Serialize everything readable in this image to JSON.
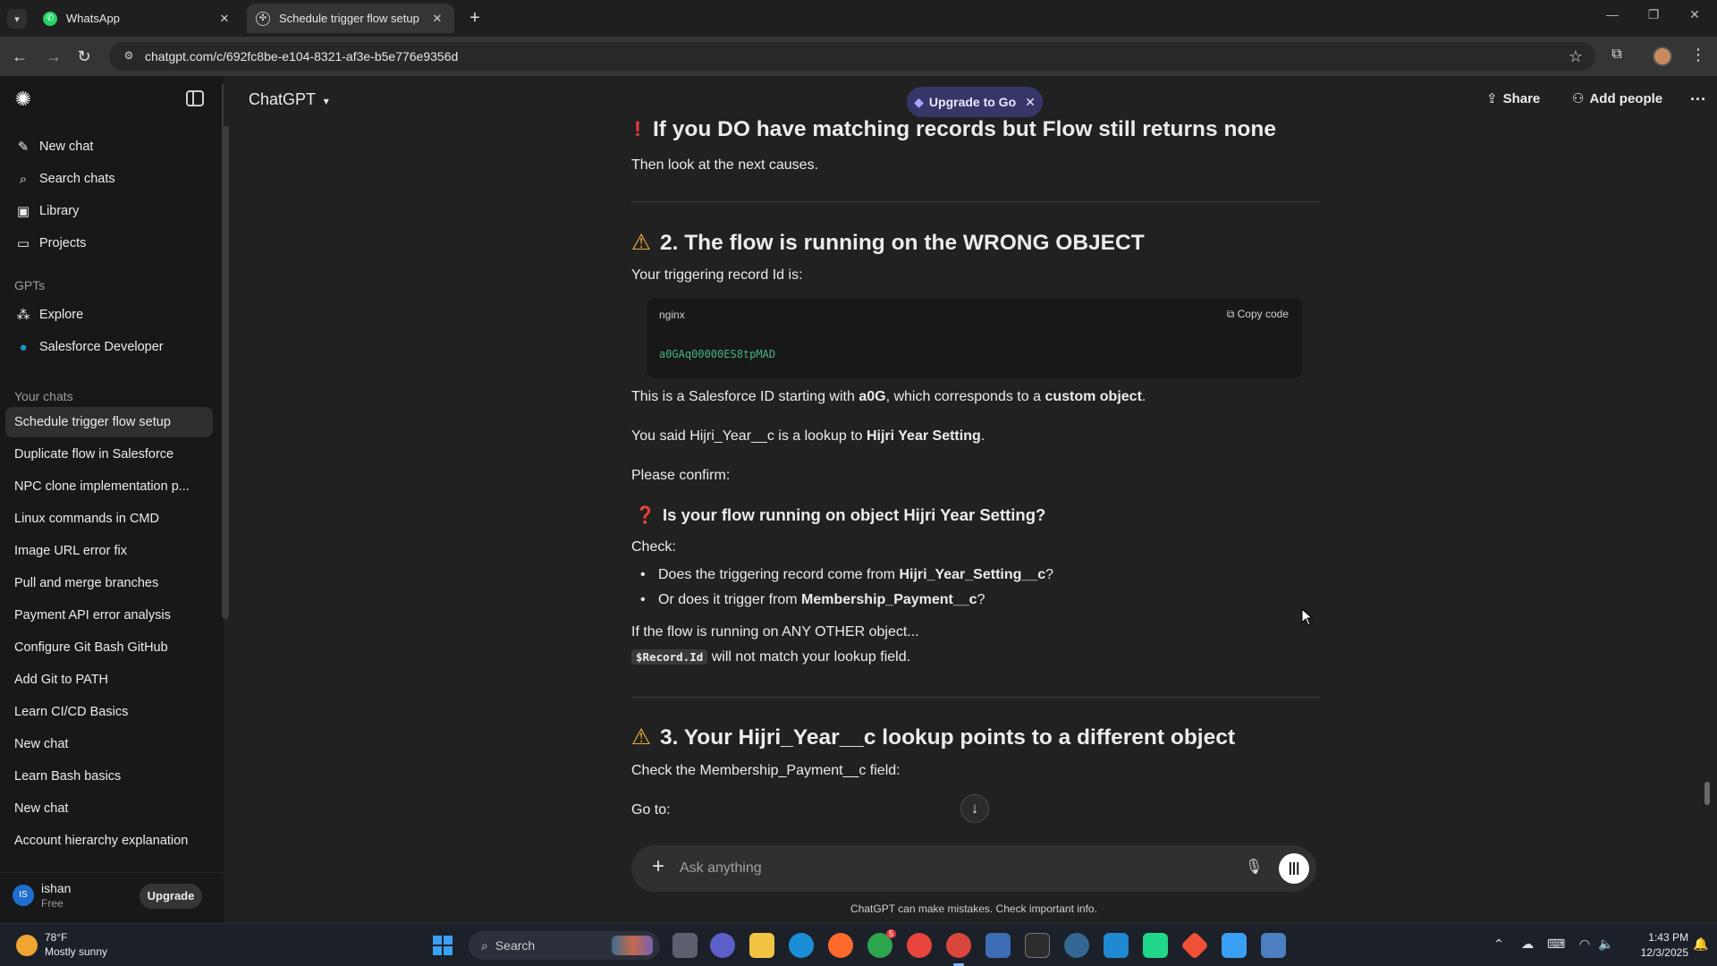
{
  "browser": {
    "tabs": [
      {
        "title": "WhatsApp",
        "active": false
      },
      {
        "title": "Schedule trigger flow setup",
        "active": true
      }
    ],
    "url": "chatgpt.com/c/692fc8be-e104-8321-af3e-b5e776e9356d"
  },
  "sidebar": {
    "top_items": [
      {
        "label": "New chat",
        "icon": "edit-icon"
      },
      {
        "label": "Search chats",
        "icon": "search-icon"
      },
      {
        "label": "Library",
        "icon": "library-icon"
      },
      {
        "label": "Projects",
        "icon": "folder-icon"
      }
    ],
    "gpts_heading": "GPTs",
    "gpts": [
      {
        "label": "Explore",
        "icon": "grid-icon"
      },
      {
        "label": "Salesforce Developer",
        "icon": "salesforce-icon"
      }
    ],
    "chats_heading": "Your chats",
    "chats": [
      "Schedule trigger flow setup",
      "Duplicate flow in Salesforce",
      "NPC clone implementation p...",
      "Linux commands in CMD",
      "Image URL error fix",
      "Pull and merge branches",
      "Payment API error analysis",
      "Configure Git Bash GitHub",
      "Add Git to PATH",
      "Learn CI/CD Basics",
      "New chat",
      "Learn Bash basics",
      "New chat",
      "Account hierarchy explanation"
    ],
    "user": {
      "initials": "IS",
      "name": "ishan",
      "plan": "Free",
      "upgrade_label": "Upgrade"
    }
  },
  "header": {
    "model": "ChatGPT",
    "upgrade_pill": "Upgrade to Go",
    "share": "Share",
    "add_people": "Add people"
  },
  "message": {
    "h_none": "If you DO have matching records but Flow still returns none",
    "p_next": "Then look at the next causes.",
    "h_wrong": "2. The flow is running on the WRONG OBJECT",
    "p_trigger": "Your triggering record Id is:",
    "code": {
      "lang": "nginx",
      "copy": "Copy code",
      "line": "a0GAq00000ES8tpMAD"
    },
    "p_sf_1": "This is a Salesforce ID starting with ",
    "p_sf_b1": "a0G",
    "p_sf_2": ", which corresponds to a ",
    "p_sf_b2": "custom object",
    "p_sf_3": ".",
    "p_said_1": "You said Hijri_Year__c is a lookup to ",
    "p_said_b": "Hijri Year Setting",
    "p_said_2": ".",
    "p_confirm": "Please confirm:",
    "h_q": "Is your flow running on object Hijri Year Setting?",
    "p_check": "Check:",
    "b1_1": "Does the triggering record come from ",
    "b1_b": "Hijri_Year_Setting__c",
    "b1_2": "?",
    "b2_1": "Or does it trigger from ",
    "b2_b": "Membership_Payment__c",
    "b2_2": "?",
    "p_if": "If the flow is running on ANY OTHER object...",
    "p_code_inline": "$Record.Id",
    "p_match": " will not match your lookup field.",
    "h_lookup": "3. Your Hijri_Year__c lookup points to a different object",
    "p_field": "Check the Membership_Payment__c field:",
    "p_goto": "Go to:"
  },
  "composer": {
    "placeholder": "Ask anything"
  },
  "disclaimer": "ChatGPT can make mistakes. Check important info.",
  "taskbar": {
    "weather_temp": "78°F",
    "weather_desc": "Mostly sunny",
    "search": "Search",
    "time": "1:43 PM",
    "date": "12/3/2025",
    "chrome_badge": "5"
  },
  "colors": {
    "background": "#212121",
    "sidebar": "#181818",
    "upgrade_pill": "#373669",
    "code_green": "#46b37f",
    "warning": "#f2b03c",
    "exclamation": "#e0383e"
  }
}
